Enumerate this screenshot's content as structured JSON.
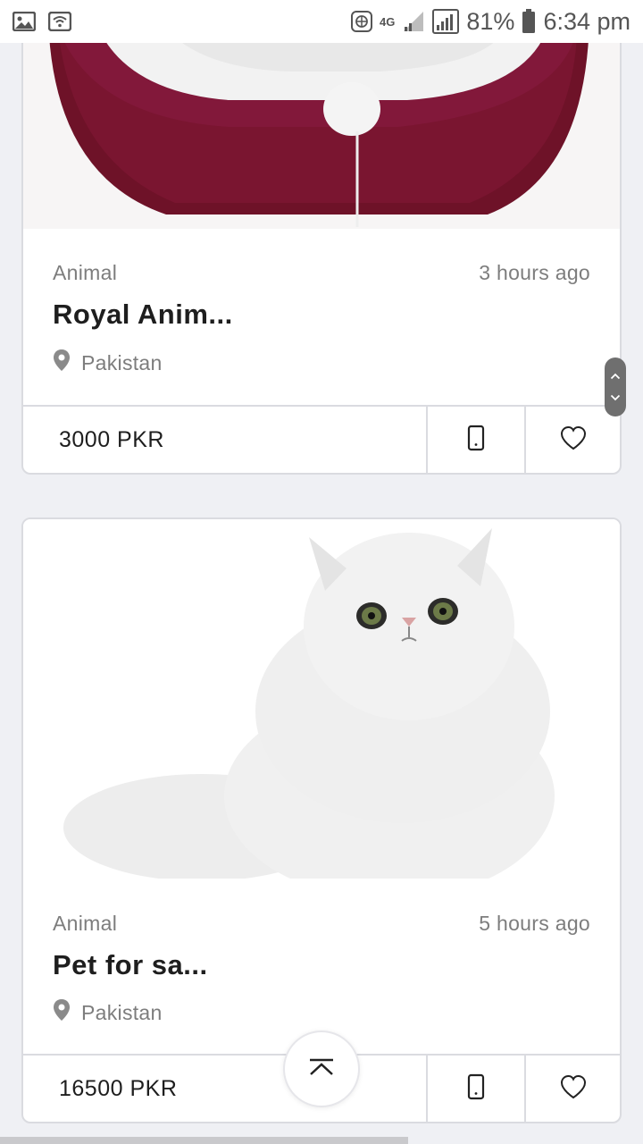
{
  "status_bar": {
    "battery_percent": "81%",
    "time": "6:34 pm",
    "network_type": "4G",
    "icons": [
      "gallery-icon",
      "wifi-icon",
      "vpn-globe-icon",
      "signal-weak-icon",
      "signal-icon",
      "battery-icon"
    ]
  },
  "listings": [
    {
      "category": "Animal",
      "posted": "3 hours ago",
      "title": "Royal Anim...",
      "location": "Pakistan",
      "price": "3000 PKR",
      "image": "maroon-pet-bed"
    },
    {
      "category": "Animal",
      "posted": "5 hours ago",
      "title": "Pet for sa...",
      "location": "Pakistan",
      "price": "16500 PKR",
      "image": "white-persian-cat"
    }
  ],
  "colors": {
    "background": "#eff0f4",
    "card": "#ffffff",
    "border": "#dadbe0",
    "text_primary": "#1e1e1e",
    "text_secondary": "#7d7d7d"
  }
}
